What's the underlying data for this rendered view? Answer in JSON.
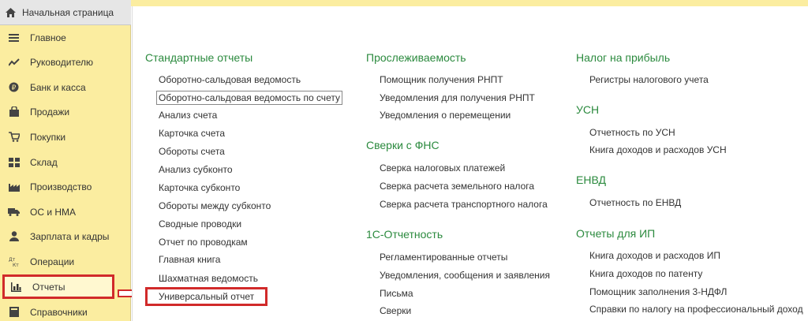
{
  "sidebar": {
    "home_label": "Начальная страница",
    "items": [
      {
        "label": "Главное",
        "icon": "menu-lines-icon"
      },
      {
        "label": "Руководителю",
        "icon": "trend-chart-icon"
      },
      {
        "label": "Банк и касса",
        "icon": "coin-icon"
      },
      {
        "label": "Продажи",
        "icon": "shopping-bag-icon"
      },
      {
        "label": "Покупки",
        "icon": "cart-icon"
      },
      {
        "label": "Склад",
        "icon": "warehouse-icon"
      },
      {
        "label": "Производство",
        "icon": "factory-icon"
      },
      {
        "label": "ОС и НМА",
        "icon": "truck-icon"
      },
      {
        "label": "Зарплата и кадры",
        "icon": "person-icon"
      },
      {
        "label": "Операции",
        "icon": "operations-icon"
      },
      {
        "label": "Отчеты",
        "icon": "bar-chart-icon",
        "active": true
      },
      {
        "label": "Справочники",
        "icon": "book-icon"
      }
    ]
  },
  "columns": [
    {
      "sections": [
        {
          "title": "Стандартные отчеты",
          "links": [
            "Оборотно-сальдовая ведомость",
            "Оборотно-сальдовая ведомость по счету",
            "Анализ счета",
            "Карточка счета",
            "Обороты счета",
            "Анализ субконто",
            "Карточка субконто",
            "Обороты между субконто",
            "Сводные проводки",
            "Отчет по проводкам",
            "Главная книга",
            "Шахматная ведомость",
            "Универсальный отчет"
          ]
        }
      ]
    },
    {
      "sections": [
        {
          "title": "Прослеживаемость",
          "links": [
            "Помощник получения РНПТ",
            "Уведомления для получения РНПТ",
            "Уведомления о перемещении"
          ]
        },
        {
          "title": "Сверки с ФНС",
          "links": [
            "Сверка налоговых платежей",
            "Сверка расчета земельного налога",
            "Сверка расчета транспортного налога"
          ]
        },
        {
          "title": "1С-Отчетность",
          "links": [
            "Регламентированные отчеты",
            "Уведомления, сообщения и заявления",
            "Письма",
            "Сверки"
          ]
        }
      ]
    },
    {
      "sections": [
        {
          "title": "Налог на прибыль",
          "links": [
            "Регистры налогового учета"
          ]
        },
        {
          "title": "УСН",
          "links": [
            "Отчетность по УСН",
            "Книга доходов и расходов УСН"
          ]
        },
        {
          "title": "ЕНВД",
          "links": [
            "Отчетность по ЕНВД"
          ]
        },
        {
          "title": "Отчеты для ИП",
          "links": [
            "Книга доходов и расходов ИП",
            "Книга доходов по патенту",
            "Помощник заполнения 3-НДФЛ",
            "Справки по налогу на профессиональный доход"
          ]
        }
      ]
    }
  ],
  "colors": {
    "section_title": "#2b8a3e",
    "sidebar_bg": "#fbeda0",
    "highlight": "#d12a2a"
  }
}
